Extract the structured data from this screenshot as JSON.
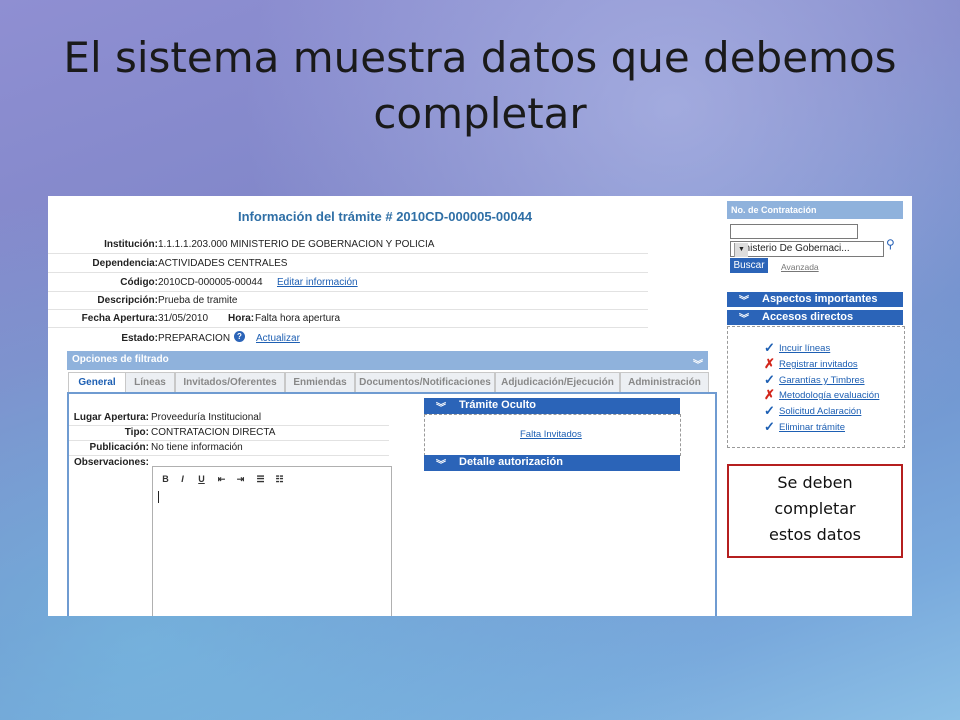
{
  "slide": {
    "title_line1": "El sistema muestra datos que debemos",
    "title_line2": "completar"
  },
  "app": {
    "title": "Información del trámite # 2010CD-000005-00044",
    "info": [
      {
        "label": "Institución:",
        "value": "1.1.1.1.203.000   MINISTERIO DE GOBERNACION Y POLICIA"
      },
      {
        "label": "Dependencia:",
        "value": "ACTIVIDADES CENTRALES"
      },
      {
        "label": "Código:",
        "value": "2010CD-000005-00044",
        "link": "Editar información"
      },
      {
        "label": "Descripción:",
        "value": "Prueba de tramite"
      },
      {
        "label": "Fecha Apertura:",
        "value": "31/05/2010",
        "extra_label": "Hora:",
        "extra_value": "Falta hora apertura"
      },
      {
        "label": "Estado:",
        "value": "PREPARACION",
        "link": "Actualizar"
      }
    ],
    "filter_label": "Opciones de filtrado",
    "tabs": [
      "General",
      "Líneas",
      "Invitados/Oferentes",
      "Enmiendas",
      "Documentos/Notificaciones",
      "Adjudicación/Ejecución",
      "Administración"
    ],
    "general": [
      {
        "label": "Lugar Apertura:",
        "value": "Proveeduría Institucional"
      },
      {
        "label": "Tipo:",
        "value": "CONTRATACION DIRECTA"
      },
      {
        "label": "Publicación:",
        "value": "No tiene información"
      },
      {
        "label": "Observaciones:",
        "value": ""
      }
    ],
    "editor_tools": [
      "B",
      "I",
      "U",
      "⇤",
      "⇥",
      "☰",
      "☷"
    ],
    "tramite_oculto": {
      "title": "Trámite Oculto",
      "link": "Falta Invitados"
    },
    "detalle": {
      "title": "Detalle autorización"
    },
    "sidebar": {
      "head": "No. de Contratación",
      "search_value": "",
      "select_value": "Ministerio De Gobernaci...",
      "buscar": "Buscar",
      "avanzada": "Avanzada",
      "aspectos": "Aspectos importantes",
      "accesos": "Accesos directos",
      "items": [
        {
          "label": "Incuir líneas",
          "status": "ok"
        },
        {
          "label": "Registrar invitados",
          "status": "bad"
        },
        {
          "label": "Garantías y Timbres",
          "status": "ok"
        },
        {
          "label": "Metodología evaluación",
          "status": "bad"
        },
        {
          "label": "Solicitud Aclaración",
          "status": "ok"
        },
        {
          "label": "Eliminar trámite",
          "status": "ok"
        }
      ]
    }
  },
  "callout": {
    "line1": "Se deben",
    "line2": "completar",
    "line3": "estos datos",
    "border_color": "#b51f1f"
  },
  "colors": {
    "accent": "#2b64b8",
    "link": "#1d5fb3",
    "header_light": "#8fb2dc"
  }
}
